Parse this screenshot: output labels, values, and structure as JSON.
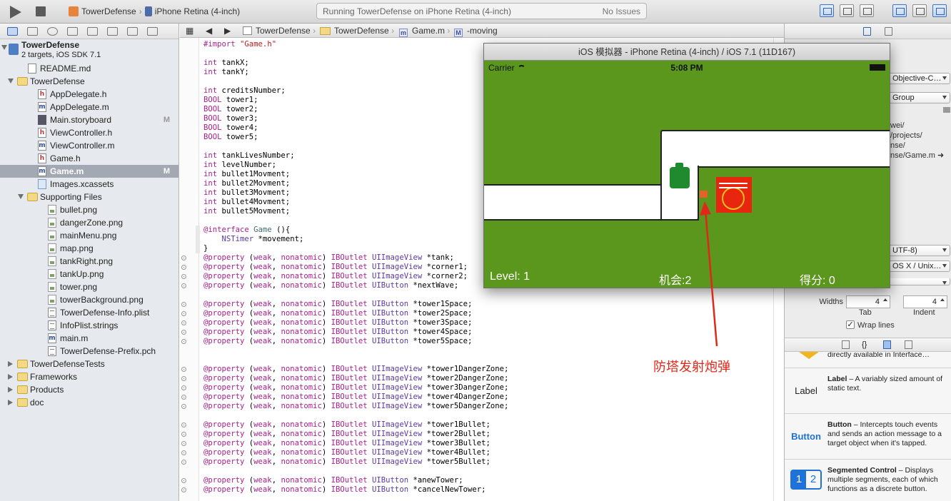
{
  "toolbar": {
    "scheme": "TowerDefense",
    "destination": "iPhone Retina (4-inch)",
    "status": "Running TowerDefense on iPhone Retina (4-inch)",
    "issues": "No Issues"
  },
  "navigator": {
    "project_name": "TowerDefense",
    "project_sub": "2 targets, iOS SDK 7.1",
    "items": [
      {
        "label": "README.md",
        "kind": "file",
        "badge": ""
      },
      {
        "label": "TowerDefense",
        "kind": "folder",
        "badge": ""
      },
      {
        "label": "AppDelegate.h",
        "kind": "h",
        "badge": ""
      },
      {
        "label": "AppDelegate.m",
        "kind": "m",
        "badge": ""
      },
      {
        "label": "Main.storyboard",
        "kind": "sb",
        "badge": "M"
      },
      {
        "label": "ViewController.h",
        "kind": "h",
        "badge": ""
      },
      {
        "label": "ViewController.m",
        "kind": "m",
        "badge": ""
      },
      {
        "label": "Game.h",
        "kind": "h",
        "badge": ""
      },
      {
        "label": "Game.m",
        "kind": "m",
        "badge": "M"
      },
      {
        "label": "Images.xcassets",
        "kind": "xc",
        "badge": ""
      },
      {
        "label": "Supporting Files",
        "kind": "folder",
        "badge": ""
      },
      {
        "label": "bullet.png",
        "kind": "png",
        "badge": ""
      },
      {
        "label": "dangerZone.png",
        "kind": "png",
        "badge": ""
      },
      {
        "label": "mainMenu.png",
        "kind": "png",
        "badge": ""
      },
      {
        "label": "map.png",
        "kind": "png",
        "badge": ""
      },
      {
        "label": "tankRight.png",
        "kind": "png",
        "badge": ""
      },
      {
        "label": "tankUp.png",
        "kind": "png",
        "badge": ""
      },
      {
        "label": "tower.png",
        "kind": "png",
        "badge": ""
      },
      {
        "label": "towerBackground.png",
        "kind": "png",
        "badge": ""
      },
      {
        "label": "TowerDefense-Info.plist",
        "kind": "plist",
        "badge": ""
      },
      {
        "label": "InfoPlist.strings",
        "kind": "plist",
        "badge": ""
      },
      {
        "label": "main.m",
        "kind": "m",
        "badge": ""
      },
      {
        "label": "TowerDefense-Prefix.pch",
        "kind": "plist",
        "badge": ""
      },
      {
        "label": "TowerDefenseTests",
        "kind": "folder",
        "badge": ""
      },
      {
        "label": "Frameworks",
        "kind": "folder",
        "badge": ""
      },
      {
        "label": "Products",
        "kind": "folder",
        "badge": ""
      },
      {
        "label": "doc",
        "kind": "folder",
        "badge": ""
      }
    ]
  },
  "jumpbar": {
    "project": "TowerDefense",
    "group": "TowerDefense",
    "file": "Game.m",
    "symbol": "-moving"
  },
  "editor": {
    "lines": [
      "#import \"Game.h\"",
      "",
      "int tankX;",
      "int tankY;",
      "",
      "int creditsNumber;",
      "BOOL tower1;",
      "BOOL tower2;",
      "BOOL tower3;",
      "BOOL tower4;",
      "BOOL tower5;",
      "",
      "int tankLivesNumber;",
      "int levelNumber;",
      "int bullet1Movment;",
      "int bullet2Movment;",
      "int bullet3Movment;",
      "int bullet4Movment;",
      "int bullet5Movment;",
      "",
      "@interface Game (){",
      "    NSTimer *movement;",
      "}",
      "@property (weak, nonatomic) IBOutlet UIImageView *tank;",
      "@property (weak, nonatomic) IBOutlet UIImageView *corner1;",
      "@property (weak, nonatomic) IBOutlet UIImageView *corner2;",
      "@property (weak, nonatomic) IBOutlet UIButton *nextWave;",
      "",
      "@property (weak, nonatomic) IBOutlet UIButton *tower1Space;",
      "@property (weak, nonatomic) IBOutlet UIButton *tower2Space;",
      "@property (weak, nonatomic) IBOutlet UIButton *tower3Space;",
      "@property (weak, nonatomic) IBOutlet UIButton *tower4Space;",
      "@property (weak, nonatomic) IBOutlet UIButton *tower5Space;",
      "",
      "",
      "@property (weak, nonatomic) IBOutlet UIImageView *tower1DangerZone;",
      "@property (weak, nonatomic) IBOutlet UIImageView *tower2DangerZone;",
      "@property (weak, nonatomic) IBOutlet UIImageView *tower3DangerZone;",
      "@property (weak, nonatomic) IBOutlet UIImageView *tower4DangerZone;",
      "@property (weak, nonatomic) IBOutlet UIImageView *tower5DangerZone;",
      "",
      "@property (weak, nonatomic) IBOutlet UIImageView *tower1Bullet;",
      "@property (weak, nonatomic) IBOutlet UIImageView *tower2Bullet;",
      "@property (weak, nonatomic) IBOutlet UIImageView *tower3Bullet;",
      "@property (weak, nonatomic) IBOutlet UIImageView *tower4Bullet;",
      "@property (weak, nonatomic) IBOutlet UIImageView *tower5Bullet;",
      "",
      "@property (weak, nonatomic) IBOutlet UIButton *anewTower;",
      "@property (weak, nonatomic) IBOutlet UIButton *cancelNewTower;"
    ]
  },
  "simulator": {
    "title": "iOS 模拟器 - iPhone Retina (4-inch) / iOS 7.1 (11D167)",
    "carrier": "Carrier",
    "time": "5:08 PM",
    "level": "Level: 1",
    "chances": "机会:2",
    "score": "得分:  0"
  },
  "annotation": {
    "text": "防塔发射炮弹"
  },
  "inspector": {
    "lang_pop": "Objective-C…",
    "loc_pop": "Group",
    "path_lines": [
      "wei/",
      "/projects/",
      "nse/",
      "nse/Game.m"
    ],
    "encoding_pop": "UTF-8)",
    "line_endings_pop": "OS X / Unix…",
    "widths_label": "Widths",
    "tab_value": "4",
    "indent_value": "4",
    "tab_label": "Tab",
    "indent_label": "Indent",
    "wrap_label": "Wrap lines"
  },
  "library": {
    "partial_desc": "directly available in Interface…",
    "items": [
      {
        "icon_text": "Label",
        "title": "Label",
        "desc": " – A variably sized amount of static text."
      },
      {
        "icon_text": "Button",
        "title": "Button",
        "desc": " – Intercepts touch events and sends an action message to a target object when it's tapped."
      },
      {
        "icon_text": "1 2",
        "title": "Segmented Control",
        "desc": " – Displays multiple segments, each of which functions as a discrete button."
      }
    ]
  }
}
